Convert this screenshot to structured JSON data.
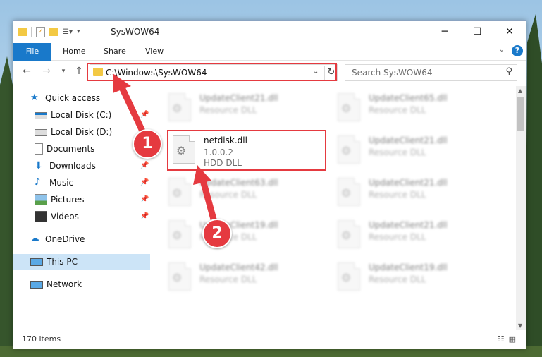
{
  "window": {
    "title": "SysWOW64"
  },
  "ribbon": {
    "tabs": [
      "File",
      "Home",
      "Share",
      "View"
    ]
  },
  "address": {
    "path": "C:\\Windows\\SysWOW64"
  },
  "search": {
    "placeholder": "Search SysWOW64"
  },
  "sidebar": {
    "items": [
      {
        "label": "Quick access",
        "icon": "star-icon"
      },
      {
        "label": "Local Disk (C:)",
        "icon": "drive-icon"
      },
      {
        "label": "Local Disk (D:)",
        "icon": "drive-icon"
      },
      {
        "label": "Documents",
        "icon": "documents-icon"
      },
      {
        "label": "Downloads",
        "icon": "download-icon"
      },
      {
        "label": "Music",
        "icon": "music-icon"
      },
      {
        "label": "Pictures",
        "icon": "pictures-icon"
      },
      {
        "label": "Videos",
        "icon": "videos-icon"
      },
      {
        "label": "OneDrive",
        "icon": "cloud-icon"
      },
      {
        "label": "This PC",
        "icon": "computer-icon"
      },
      {
        "label": "Network",
        "icon": "network-icon"
      }
    ]
  },
  "files": {
    "highlighted": {
      "name": "netdisk.dll",
      "version": "1.0.0.2",
      "desc": "HDD DLL"
    },
    "blurred": [
      {
        "name": "UpdateClient21.dll",
        "desc": "Resource DLL"
      },
      {
        "name": "UpdateClient65.dll",
        "desc": "Resource DLL"
      },
      {
        "name": "UpdateClient21.dll",
        "desc": "Resource DLL"
      },
      {
        "name": "UpdateClient63.dll",
        "desc": "Resource DLL"
      },
      {
        "name": "UpdateClient21.dll",
        "desc": "Resource DLL"
      },
      {
        "name": "UpdateClient19.dll",
        "desc": "Resource DLL"
      },
      {
        "name": "UpdateClient21.dll",
        "desc": "Resource DLL"
      },
      {
        "name": "UpdateClient42.dll",
        "desc": "Resource DLL"
      },
      {
        "name": "UpdateClient19.dll",
        "desc": "Resource DLL"
      }
    ]
  },
  "status": {
    "count": "170 items"
  },
  "callouts": {
    "one": "1",
    "two": "2"
  },
  "colors": {
    "accent": "#1979ca",
    "highlight": "#e53a40",
    "selection": "#cce4f7"
  }
}
